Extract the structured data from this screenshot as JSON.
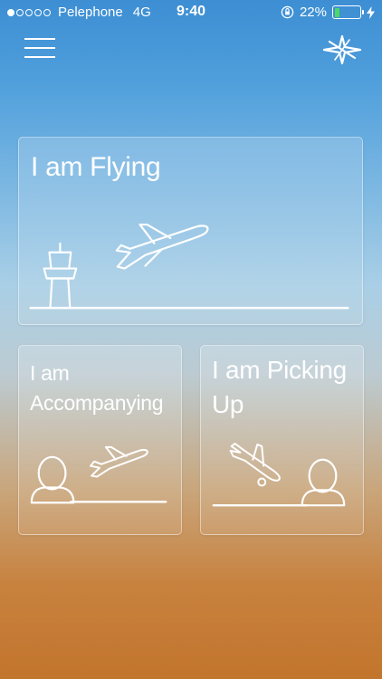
{
  "status_bar": {
    "carrier": "Pelephone",
    "network": "4G",
    "time": "9:40",
    "battery_percent": "22%",
    "battery_level": 0.22,
    "signal_bars": 1,
    "signal_total": 5
  },
  "nav": {
    "menu_icon": "hamburger-menu-icon",
    "logo_icon": "airport-logo-icon"
  },
  "cards": {
    "flying": {
      "title": "I am Flying"
    },
    "accompanying": {
      "title_line1": "I am",
      "title_line2": "Accompanying"
    },
    "picking_up": {
      "title_line1": "I am Picking",
      "title_line2": "Up"
    }
  },
  "colors": {
    "gradient_top": "#3d8ed3",
    "gradient_mid": "#a9cfe6",
    "gradient_bottom": "#c2752c",
    "battery_fill": "#4cd964"
  }
}
